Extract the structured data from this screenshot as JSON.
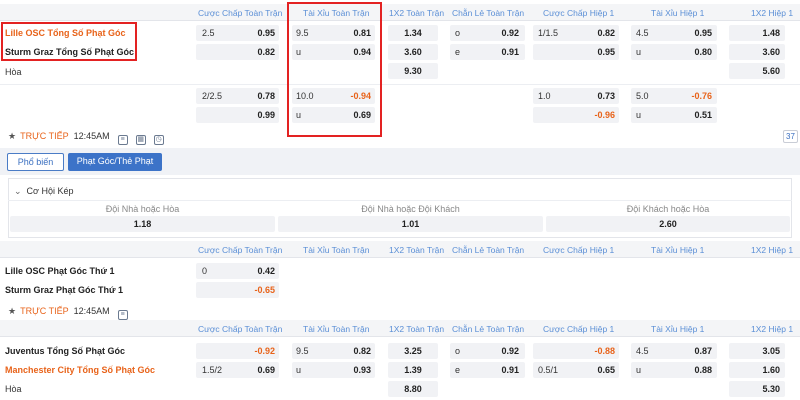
{
  "columns": [
    "Cược Chấp Toàn Trận",
    "Tài Xỉu Toàn Trận",
    "1X2 Toàn Trận",
    "Chẵn Lẻ Toàn Trận",
    "Cược Chấp Hiệp 1",
    "Tài Xỉu Hiệp 1",
    "1X2 Hiệp 1"
  ],
  "match1": {
    "home": "Lille OSC Tổng Số Phạt Góc",
    "away": "Sturm Graz Tổng Số Phạt Góc",
    "draw": "Hòa",
    "r1": {
      "hcp_line": "2.5",
      "hcp": "0.95",
      "ou_line": "9.5",
      "ou": "0.81",
      "x12": "1.34",
      "oe_lbl": "o",
      "oe": "0.92",
      "h1_line": "1/1.5",
      "h1": "0.82",
      "h1ou_line": "4.5",
      "h1ou": "0.95",
      "h1x12": "1.48"
    },
    "r2": {
      "hcp": "0.82",
      "ou_lbl": "u",
      "ou": "0.94",
      "x12": "3.60",
      "oe_lbl": "e",
      "oe": "0.91",
      "h1": "0.95",
      "h1ou_lbl": "u",
      "h1ou": "0.80",
      "h1x12": "3.60"
    },
    "r3": {
      "x12": "9.30",
      "h1x12": "5.60"
    },
    "r4": {
      "hcp_line": "2/2.5",
      "hcp": "0.78",
      "ou_line": "10.0",
      "ou": "-0.94",
      "h1_line": "1.0",
      "h1": "0.73",
      "h1ou_line": "5.0",
      "h1ou": "-0.76"
    },
    "r5": {
      "hcp": "0.99",
      "ou_lbl": "u",
      "ou": "0.69",
      "h1": "-0.96",
      "h1ou_lbl": "u",
      "h1ou": "0.51"
    },
    "live": "TRỰC TIẾP",
    "time": "12:45AM",
    "count": "37"
  },
  "tabs": {
    "popular": "Phổ biến",
    "corner": "Phạt Góc/Thẻ Phạt"
  },
  "double_chance": {
    "title": "Cơ Hội Kép",
    "items": [
      {
        "label": "Đội Nhà hoặc Hòa",
        "value": "1.18"
      },
      {
        "label": "Đội Nhà hoặc Đội Khách",
        "value": "1.01"
      },
      {
        "label": "Đội Khách hoặc Hòa",
        "value": "2.60"
      }
    ]
  },
  "match2": {
    "home": "Lille OSC Phạt Góc Thứ 1",
    "away": "Sturm Graz Phạt Góc Thứ 1",
    "r1": {
      "hcp_line": "0",
      "hcp": "0.42"
    },
    "r2": {
      "hcp": "-0.65"
    },
    "live": "TRỰC TIẾP",
    "time": "12:45AM"
  },
  "match3": {
    "home": "Juventus Tổng Số Phạt Góc",
    "away": "Manchester City Tổng Số Phạt Góc",
    "draw": "Hòa",
    "r1": {
      "hcp": "-0.92",
      "ou_line": "9.5",
      "ou": "0.82",
      "x12": "3.25",
      "oe_lbl": "o",
      "oe": "0.92",
      "h1": "-0.88",
      "h1ou_line": "4.5",
      "h1ou": "0.87",
      "h1x12": "3.05"
    },
    "r2": {
      "hcp_line": "1.5/2",
      "hcp": "0.69",
      "ou_lbl": "u",
      "ou": "0.93",
      "x12": "1.39",
      "oe_lbl": "e",
      "oe": "0.91",
      "h1_line": "0.5/1",
      "h1": "0.65",
      "h1ou_lbl": "u",
      "h1ou": "0.88",
      "h1x12": "1.60"
    },
    "r3": {
      "x12": "8.80",
      "h1x12": "5.30"
    }
  },
  "colors": {
    "accent": "#3c73c8",
    "highlight": "#e32222",
    "negative": "#e8631a",
    "header": "#5b8fd6"
  }
}
